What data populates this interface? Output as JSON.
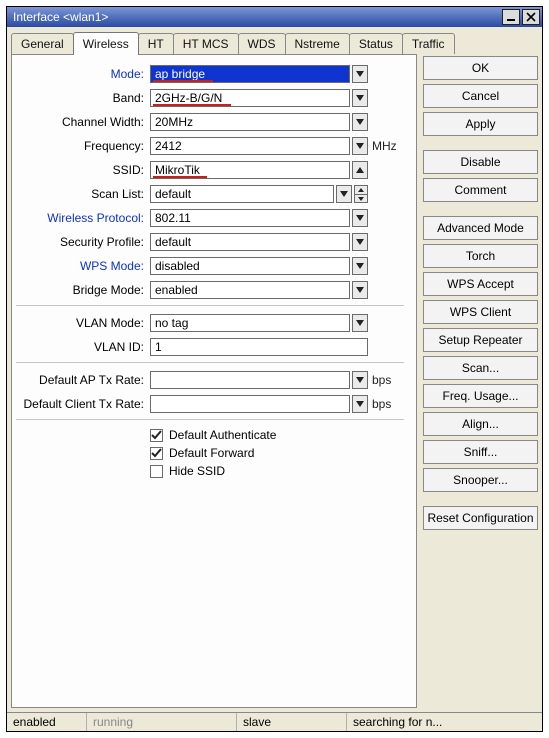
{
  "title": "Interface <wlan1>",
  "tabs": [
    "General",
    "Wireless",
    "HT",
    "HT MCS",
    "WDS",
    "Nstreme",
    "Status",
    "Traffic"
  ],
  "activeTabIndex": 1,
  "form": {
    "mode": {
      "label": "Mode:",
      "value": "ap bridge"
    },
    "band": {
      "label": "Band:",
      "value": "2GHz-B/G/N"
    },
    "channelWidth": {
      "label": "Channel Width:",
      "value": "20MHz"
    },
    "frequency": {
      "label": "Frequency:",
      "value": "2412",
      "unit": "MHz"
    },
    "ssid": {
      "label": "SSID:",
      "value": "MikroTik"
    },
    "scanList": {
      "label": "Scan List:",
      "value": "default"
    },
    "wirelessProtocol": {
      "label": "Wireless Protocol:",
      "value": "802.11"
    },
    "securityProfile": {
      "label": "Security Profile:",
      "value": "default"
    },
    "wpsMode": {
      "label": "WPS Mode:",
      "value": "disabled"
    },
    "bridgeMode": {
      "label": "Bridge Mode:",
      "value": "enabled"
    },
    "vlanMode": {
      "label": "VLAN Mode:",
      "value": "no tag"
    },
    "vlanId": {
      "label": "VLAN ID:",
      "value": "1"
    },
    "defaultApTxRate": {
      "label": "Default AP Tx Rate:",
      "value": "",
      "unit": "bps"
    },
    "defaultClientTxRate": {
      "label": "Default Client Tx Rate:",
      "value": "",
      "unit": "bps"
    }
  },
  "checkboxes": {
    "defaultAuthenticate": {
      "label": "Default Authenticate",
      "checked": true
    },
    "defaultForward": {
      "label": "Default Forward",
      "checked": true
    },
    "hideSsid": {
      "label": "Hide SSID",
      "checked": false
    }
  },
  "buttons": {
    "ok": "OK",
    "cancel": "Cancel",
    "apply": "Apply",
    "disable": "Disable",
    "comment": "Comment",
    "advancedMode": "Advanced Mode",
    "torch": "Torch",
    "wpsAccept": "WPS Accept",
    "wpsClient": "WPS Client",
    "setupRepeater": "Setup Repeater",
    "scan": "Scan...",
    "freqUsage": "Freq. Usage...",
    "align": "Align...",
    "sniff": "Sniff...",
    "snooper": "Snooper...",
    "resetConfiguration": "Reset Configuration"
  },
  "status": {
    "s1": "enabled",
    "s2": "running",
    "s3": "slave",
    "s4": "searching for n..."
  }
}
